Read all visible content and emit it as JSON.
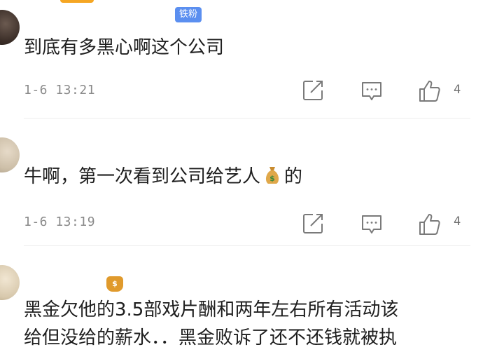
{
  "comments": [
    {
      "username": "",
      "badge": "铁粉",
      "text": "到底有多黑心啊这个公司",
      "time": "1-6 13:21",
      "likes": "4"
    },
    {
      "username": "",
      "badge": "",
      "text_before": "牛啊，第一次看到公司给艺人",
      "text_after": "的",
      "time": "1-6 13:19",
      "likes": "4"
    },
    {
      "username": "",
      "line1": "黑金欠他的3.5部戏片酬和两年左右所有活动该",
      "line2": "给但没给的薪水．．黑金败诉了还不还钱就被执"
    }
  ],
  "icons": {
    "share": "share-icon",
    "reply": "comment-icon",
    "like": "thumbs-up-icon",
    "money": "money-bag-icon"
  },
  "colors": {
    "badge": "#5b8ff0",
    "meta": "#8a8a8a",
    "text": "#1e1e1e"
  }
}
